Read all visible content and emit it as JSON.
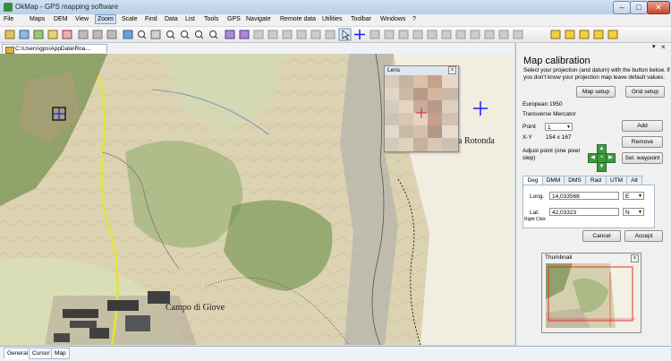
{
  "window": {
    "title": "OkMap - GPS mapping software",
    "min": "–",
    "max": "□",
    "close": "✕"
  },
  "menu": [
    "File",
    "Maps",
    "DEM",
    "View",
    "Zoom",
    "Scale",
    "Find",
    "Data",
    "List",
    "Tools",
    "GPS",
    "Navigate",
    "Remote data",
    "Utilities",
    "Toolbar",
    "Windows",
    "?"
  ],
  "doc_tab": "C:\\Users\\gps\\AppData\\Roa...",
  "map_labels": {
    "town": "Campo di Giove",
    "rotonda": "a Rotonda"
  },
  "lens": {
    "title": "Lens",
    "close": "x"
  },
  "calibration": {
    "title": "Map calibration",
    "instructions": "Select your projection (and datum) with the button below. If you don't know your projection map leave default values.",
    "map_setup": "Map setup",
    "grid_setup": "Grid setup",
    "datum": "European 1950",
    "projection": "Transverse Mercator",
    "point_label": "Point",
    "point_value": "1",
    "add": "Add",
    "xy_label": "X-Y",
    "xy_value": "154 x 167",
    "remove": "Remove",
    "adjust_label": "Adjust point (one pixel step)",
    "sel_waypoint": "Sel. waypoint",
    "tabs": [
      "Deg",
      "DMM",
      "DMS",
      "Rad",
      "UTM",
      "Alt"
    ],
    "long_label": "Long.",
    "long_value": "14,033568",
    "long_dir": "E",
    "lat_label": "Lat.",
    "lat_value": "42,03323",
    "lat_dir": "N",
    "right_click": "Right Click",
    "cancel": "Cancel",
    "accept": "Accept"
  },
  "thumbnail": {
    "title": "Thumbnail",
    "close": "x"
  },
  "bottom_tabs": [
    "General",
    "Cursor",
    "Map"
  ],
  "colors": {
    "accent": "#3399ff",
    "marker": "#1a1aff",
    "trail": "#e7e23a",
    "calib_green": "#3d9b3d"
  }
}
